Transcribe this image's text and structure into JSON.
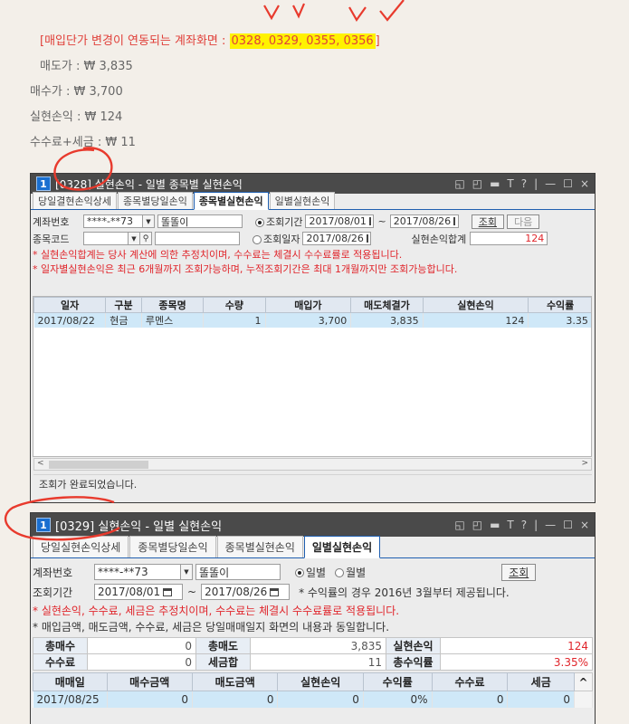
{
  "memo": {
    "title_prefix": "[매입단가 변경이 연동되는 계좌화면 : ",
    "title_highlight": "0328, 0329, 0355, 0356",
    "title_suffix": "]",
    "lines": [
      "매도가    : ₩ 3,835",
      "매수가    : ₩ 3,700",
      "실현손익   : ₩  124",
      "수수료+세금 : ₩  11"
    ]
  },
  "window1": {
    "icon": "1",
    "title": "[0328] 실현손익 - 일별 종목별 실현손익",
    "title_buttons": [
      "◱",
      "◰",
      "▬",
      "T",
      "?",
      "|",
      "—",
      "☐",
      "×"
    ],
    "tabs": [
      "당일결현손익상세",
      "종목별당일손익",
      "종목별실현손익",
      "일별실현손익"
    ],
    "active_tab": 2,
    "account_label": "계좌번호",
    "account_value": "****-**73",
    "account_name": "똘똘이",
    "period_label": "조회기간",
    "period_from": "2017/08/01",
    "period_sep": "~",
    "period_to": "2017/08/26",
    "query_button": "조회",
    "next_button": "다음",
    "stock_label": "종목코드",
    "date_label": "조회일자",
    "date_value": "2017/08/26",
    "total_label": "실현손익합계",
    "total_value": "124",
    "notes": [
      "* 실현손익합계는 당사 계산에 의한 추정치이며, 수수료는 체결시 수수료률로 적용됩니다.",
      "* 일자별실현손익은 최근 6개월까지 조회가능하며, 누적조회기간은 최대 1개월까지만 조회가능합니다."
    ],
    "columns": [
      "일자",
      "구분",
      "종목명",
      "수량",
      "매입가",
      "매도체결가",
      "실현손익",
      "수익률",
      "수"
    ],
    "rows": [
      [
        "2017/08/22",
        "현금",
        "루멘스",
        "1",
        "3,700",
        "3,835",
        "124",
        "3.35",
        ""
      ]
    ],
    "status": "조회가 완료되었습니다."
  },
  "window2": {
    "icon": "1",
    "title": "[0329] 실현손익 - 일별 실현손익",
    "title_buttons": [
      "◱",
      "◰",
      "▬",
      "T",
      "?",
      "|",
      "—",
      "☐",
      "×"
    ],
    "tabs": [
      "당일실현손익상세",
      "종목별당일손익",
      "종목별실현손익",
      "일별실현손익"
    ],
    "active_tab": 3,
    "account_label": "계좌번호",
    "account_value": "****-**73",
    "account_name": "똘똘이",
    "radio_daily": "일별",
    "radio_monthly": "월별",
    "query_button": "조회",
    "period_label": "조회기간",
    "period_from": "2017/08/01",
    "period_sep": "~",
    "period_to": "2017/08/26",
    "period_note": "* 수익률의 경우 2016년 3월부터 제공됩니다.",
    "notes_red": "* 실현손익, 수수료, 세금은 추정치이며, 수수료는 체결시 수수료률로 적용됩니다.",
    "notes_gray": "* 매입금액, 매도금액, 수수료, 세금은 당일매매일지 화면의 내용과 동일합니다.",
    "summary": [
      [
        {
          "k": "총매수"
        },
        {
          "v": "0"
        },
        {
          "k": "총매도"
        },
        {
          "v": "3,835"
        },
        {
          "k": "실현손익"
        },
        {
          "v": "124",
          "red": true
        }
      ],
      [
        {
          "k": "수수료"
        },
        {
          "v": "0"
        },
        {
          "k": "세금합"
        },
        {
          "v": "11"
        },
        {
          "k": "총수익률"
        },
        {
          "v": "3.35%",
          "red": true
        }
      ]
    ],
    "columns": [
      "매매일",
      "매수금액",
      "매도금액",
      "실현손익",
      "수익률",
      "수수료",
      "세금"
    ],
    "rows": [
      [
        "2017/08/25",
        "0",
        "0",
        "0",
        "0%",
        "0",
        "0"
      ]
    ]
  }
}
